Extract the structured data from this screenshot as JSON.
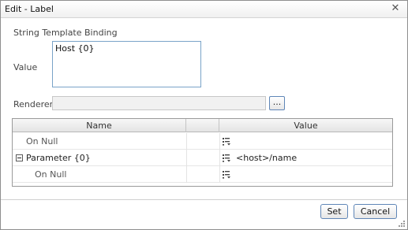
{
  "window": {
    "title": "Edit - Label"
  },
  "form": {
    "section_title": "String Template Binding",
    "value_label": "Value",
    "value_text": "Host {0}",
    "renderer_label": "Renderer",
    "renderer_value": "",
    "browse_label": "..."
  },
  "grid": {
    "columns": [
      "Name",
      "Value"
    ],
    "rows": [
      {
        "name": "On Null",
        "value": ""
      },
      {
        "name": "Parameter {0}",
        "value": "<host>/name"
      },
      {
        "name": "On Null",
        "value": ""
      }
    ]
  },
  "footer": {
    "set_label": "Set",
    "cancel_label": "Cancel"
  },
  "icons": {
    "close": "close-icon",
    "list": "list-icon",
    "expand": "collapse-icon",
    "resize": "resize-grip-icon"
  }
}
